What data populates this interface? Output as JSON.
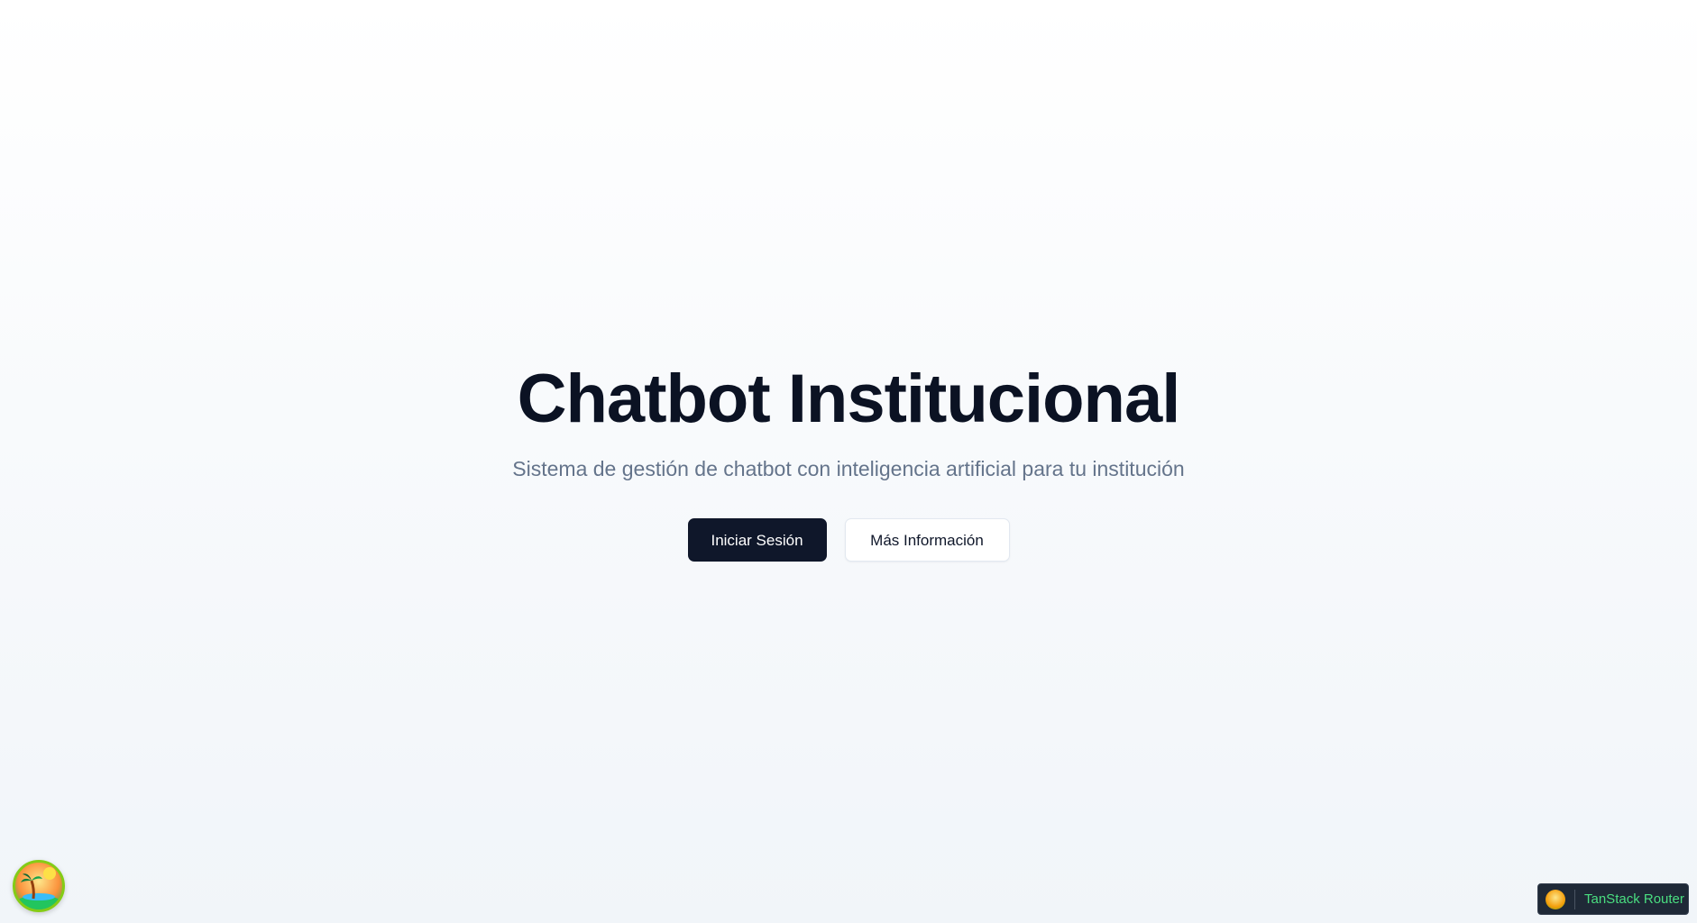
{
  "hero": {
    "title": "Chatbot Institucional",
    "subtitle": "Sistema de gestión de chatbot con inteligencia artificial para tu institución",
    "primary_button": "Iniciar Sesión",
    "secondary_button": "Más Información"
  },
  "devtools": {
    "toggle_icon": "palm-tree-island-icon",
    "router_logo_icon": "tanstack-logo-icon",
    "router_label": "TanStack Router"
  },
  "colors": {
    "title": "#0b1223",
    "subtitle": "#64748b",
    "primary_button_bg": "#0f172a",
    "router_label": "#4ade80"
  }
}
